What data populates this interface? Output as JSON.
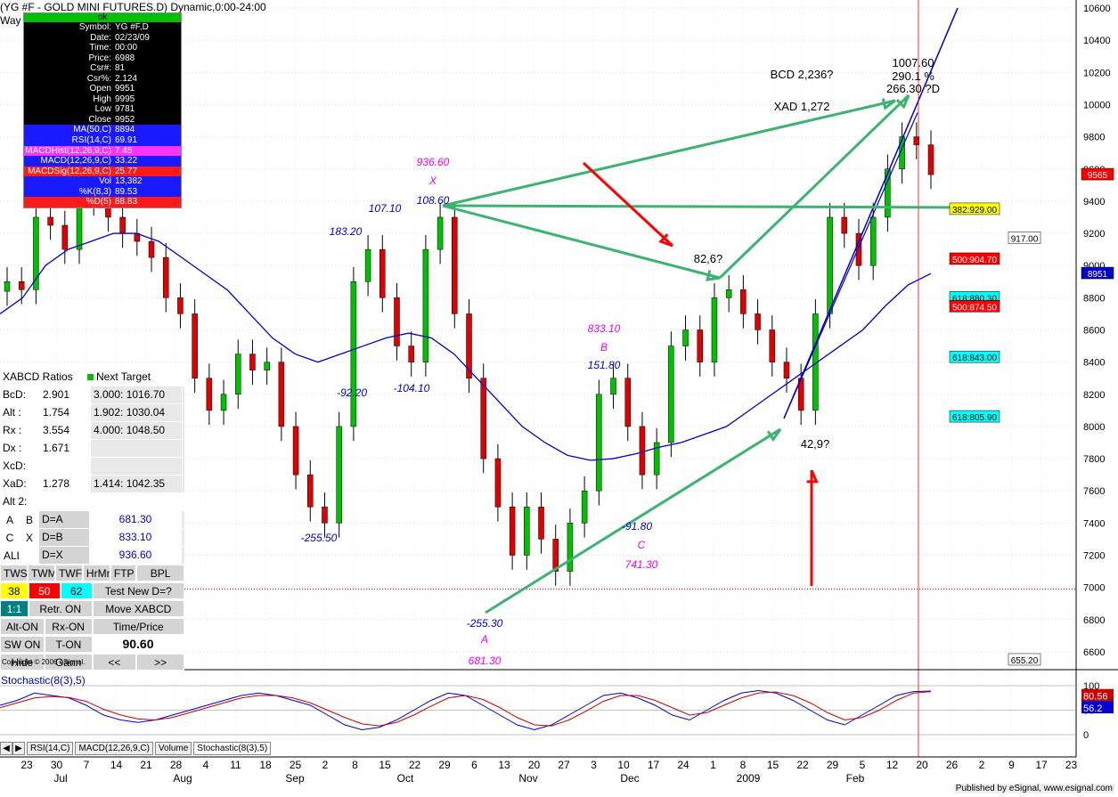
{
  "header": {
    "title": "(YG #F - GOLD MINI FUTURES.D) Dynamic,0:00-24:00",
    "wav": "Way"
  },
  "data_window": {
    "status": "ok",
    "rows": [
      {
        "k": "Symbol:",
        "v": "YG #F,D",
        "bg": "#000000"
      },
      {
        "k": "Date:",
        "v": "02/23/09",
        "bg": "#000000"
      },
      {
        "k": "Time:",
        "v": "00:00",
        "bg": "#000000"
      },
      {
        "k": "Price:",
        "v": "6988",
        "bg": "#000000"
      },
      {
        "k": "Csr#:",
        "v": "81",
        "bg": "#000000"
      },
      {
        "k": "Csr%:",
        "v": "2.124",
        "bg": "#000000"
      },
      {
        "k": "Open",
        "v": "9951",
        "bg": "#000000"
      },
      {
        "k": "High",
        "v": "9995",
        "bg": "#000000"
      },
      {
        "k": "Low",
        "v": "9781",
        "bg": "#000000"
      },
      {
        "k": "Close",
        "v": "9952",
        "bg": "#000000"
      },
      {
        "k": "MA(50,C)",
        "v": "8894",
        "bg": "#1a1aff"
      },
      {
        "k": "RSI(14,C)",
        "v": "69.91",
        "bg": "#1a1aff"
      },
      {
        "k": "MACDHist(12,26,9,C)",
        "v": "7.45",
        "bg": "#ff33ff"
      },
      {
        "k": "MACD(12,26,9,C)",
        "v": "33.22",
        "bg": "#1a1aff"
      },
      {
        "k": "MACDSig(12,26,9,C)",
        "v": "25.77",
        "bg": "#ff1a1a"
      },
      {
        "k": "Vol",
        "v": "13,382",
        "bg": "#1a1aff"
      },
      {
        "k": "%K(8,3)",
        "v": "89.53",
        "bg": "#1a1aff"
      },
      {
        "k": "%D(5)",
        "v": "88.83",
        "bg": "#ff1a1a"
      }
    ]
  },
  "xabcd_panel": {
    "title": "XABCD Ratios",
    "next_target": "Next Target",
    "ratio_rows": [
      {
        "k": "BcD:",
        "v": "2.901",
        "t": "3.000: 1016.70"
      },
      {
        "k": "Alt  :",
        "v": "1.754",
        "t": "1.902: 1030.04"
      },
      {
        "k": "Rx  :",
        "v": "3.554",
        "t": "4.000: 1048.50"
      },
      {
        "k": "Dx  :",
        "v": "1.671",
        "t": ""
      },
      {
        "k": "XcD:",
        "v": "",
        "t": ""
      },
      {
        "k": "XaD:",
        "v": "1.278",
        "t": "1.414: 1042.35"
      }
    ],
    "alt2": "Alt 2:",
    "alt_rows": [
      {
        "a": "A",
        "b": "B",
        "c": "D=A",
        "v": "681.30"
      },
      {
        "a": "C",
        "b": "X",
        "c": "D=B",
        "v": "833.10"
      },
      {
        "a": "ALL",
        "b": "",
        "c": "D=X",
        "v": "936.60"
      }
    ],
    "buttons1": [
      "TWS",
      "TWM",
      "TWF",
      "HrMn",
      "FTP",
      "BPL"
    ],
    "vals": [
      "38",
      "50",
      "62"
    ],
    "test_new": "Test New D=?",
    "ratio_btn": "1:1",
    "retr_on": "Retr. ON",
    "move": "Move XABCD",
    "alt_on": "Alt-ON",
    "rx_on": "Rx-ON",
    "time_price": "Time/Price",
    "sw_on": "SW ON",
    "t_on": "T-ON",
    "value": "90.60",
    "hide": "Hide",
    "gann": "Gann",
    "prev": "<<",
    "next": ">>"
  },
  "copyright": "Copyright © 2006 eSignal.",
  "stoch_label": "Stochastic(8(3),5)",
  "tabs": [
    "RSI(14,C)",
    "MACD(12,26,9,C)",
    "Volume",
    "Stochastic(8(3),5)"
  ],
  "published": "Published by eSignal, www.esignal.com",
  "colors": {
    "up": "#00c000",
    "down": "#e00000",
    "ma": "#0000cc",
    "arrow_green": "#3cb371",
    "arrow_red": "#ff0000",
    "label_blue": "#0000cc",
    "label_magenta": "#ee00ee"
  },
  "chart_data": {
    "type": "candlestick",
    "y_range": [
      6500,
      10650
    ],
    "y_ticks": [
      "10600",
      "10400",
      "10200",
      "10000",
      "9800",
      "9600",
      "9400",
      "9200",
      "9000",
      "8800",
      "8600",
      "8400",
      "8200",
      "8000",
      "7800",
      "7600",
      "7400",
      "7200",
      "7000",
      "6800",
      "6600"
    ],
    "x_ticks": [
      "23",
      "30",
      "7",
      "14",
      "21",
      "28",
      "4",
      "11",
      "18",
      "25",
      "2",
      "8",
      "15",
      "22",
      "29",
      "6",
      "13",
      "20",
      "27",
      "3",
      "10",
      "17",
      "24",
      "1",
      "8",
      "15",
      "22",
      "29",
      "5",
      "12",
      "20",
      "26",
      "2",
      "9",
      "17",
      "23"
    ],
    "month_labels": [
      "Jul",
      "Aug",
      "Sep",
      "Oct",
      "Nov",
      "Dec",
      "2009",
      "Feb"
    ],
    "close_series": [
      8900,
      8850,
      9300,
      9250,
      9100,
      9400,
      9450,
      9300,
      9200,
      9150,
      9050,
      8800,
      8700,
      8300,
      8100,
      8200,
      8450,
      8350,
      8400,
      8000,
      7700,
      7500,
      7400,
      8000,
      8900,
      9100,
      8800,
      8500,
      8400,
      9100,
      9300,
      8700,
      8300,
      7800,
      7500,
      7200,
      7500,
      7300,
      7100,
      7400,
      7600,
      8200,
      8300,
      8000,
      7700,
      7900,
      8500,
      8600,
      8400,
      8800,
      8850,
      8700,
      8600,
      8400,
      8300,
      8100,
      8700,
      9300,
      9200,
      9000,
      9300,
      9600,
      9800,
      9750,
      9565
    ],
    "ma_series": [
      8700,
      8800,
      9000,
      9100,
      9150,
      9200,
      9200,
      9150,
      9050,
      8950,
      8850,
      8700,
      8550,
      8450,
      8400,
      8450,
      8500,
      8550,
      8580,
      8550,
      8450,
      8300,
      8150,
      8000,
      7900,
      7820,
      7790,
      7800,
      7830,
      7870,
      7900,
      7950,
      8000,
      8100,
      8200,
      8300,
      8400,
      8500,
      8600,
      8750,
      8880,
      8950
    ],
    "stoch_k": [
      60,
      70,
      85,
      80,
      75,
      60,
      40,
      30,
      25,
      30,
      40,
      50,
      60,
      70,
      80,
      85,
      80,
      70,
      60,
      40,
      20,
      10,
      15,
      30,
      50,
      70,
      85,
      80,
      60,
      40,
      20,
      10,
      20,
      40,
      60,
      80,
      85,
      75,
      60,
      40,
      30,
      50,
      70,
      85,
      90,
      85,
      70,
      50,
      30,
      20,
      40,
      60,
      80,
      88,
      89
    ],
    "stoch_d": [
      55,
      65,
      75,
      78,
      76,
      68,
      52,
      40,
      32,
      30,
      35,
      45,
      55,
      65,
      75,
      80,
      80,
      75,
      65,
      50,
      35,
      22,
      18,
      25,
      40,
      58,
      75,
      80,
      72,
      55,
      35,
      20,
      18,
      30,
      48,
      68,
      80,
      80,
      70,
      55,
      40,
      45,
      60,
      75,
      85,
      87,
      80,
      65,
      45,
      30,
      35,
      50,
      70,
      85,
      88
    ],
    "stoch_levels": [
      "100",
      "50",
      "0"
    ],
    "stoch_current": [
      "80.56",
      "56.2"
    ],
    "price_markers": [
      {
        "label": "382:929.00",
        "price": 9350,
        "bg": "#ffff00"
      },
      {
        "label": "917.00",
        "price": 9170,
        "bg": "#ffffff"
      },
      {
        "label": "500:904.70",
        "price": 9040,
        "bg": "#ff0000"
      },
      {
        "label": "8951",
        "price": 8951,
        "bg": "#0000cc"
      },
      {
        "label": "618:880.30",
        "price": 8800,
        "bg": "#00ffff"
      },
      {
        "label": "500:874.50",
        "price": 8745,
        "bg": "#ff0000"
      },
      {
        "label": "618:843.00",
        "price": 8430,
        "bg": "#00ffff"
      },
      {
        "label": "618:805.90",
        "price": 8060,
        "bg": "#00ffff"
      },
      {
        "label": "655.20",
        "price": 6550,
        "bg": "#ffffff"
      },
      {
        "label": "9565",
        "price": 9565,
        "bg": "#ff0000"
      }
    ],
    "annotations": [
      {
        "text": "936.60",
        "color": "#ee00ee"
      },
      {
        "text": "X",
        "color": "#ee00ee"
      },
      {
        "text": "108.60",
        "color": "#0000cc"
      },
      {
        "text": "107.10",
        "color": "#0000cc"
      },
      {
        "text": "183.20",
        "color": "#0000cc"
      },
      {
        "text": "-92.20",
        "color": "#0000cc"
      },
      {
        "text": "-104.10",
        "color": "#0000cc"
      },
      {
        "text": "-255.50",
        "color": "#0000cc"
      },
      {
        "text": "833.10",
        "color": "#ee00ee"
      },
      {
        "text": "B",
        "color": "#ee00ee"
      },
      {
        "text": "151.80",
        "color": "#0000cc"
      },
      {
        "text": "-91.80",
        "color": "#0000cc"
      },
      {
        "text": "C",
        "color": "#ee00ee"
      },
      {
        "text": "741.30",
        "color": "#ee00ee"
      },
      {
        "text": "-255.30",
        "color": "#0000cc"
      },
      {
        "text": "A",
        "color": "#ee00ee"
      },
      {
        "text": "681.30",
        "color": "#ee00ee"
      },
      {
        "text": "82,6?",
        "color": "#000000"
      },
      {
        "text": "42,9?",
        "color": "#000000"
      },
      {
        "text": "BCD 2,236?",
        "color": "#000000"
      },
      {
        "text": "XAD 1,272",
        "color": "#000000"
      },
      {
        "text": "1007.60",
        "color": "#000000"
      },
      {
        "text": "290.1 %",
        "color": "#000000"
      },
      {
        "text": "266.30 ?D",
        "color": "#000000"
      }
    ]
  }
}
